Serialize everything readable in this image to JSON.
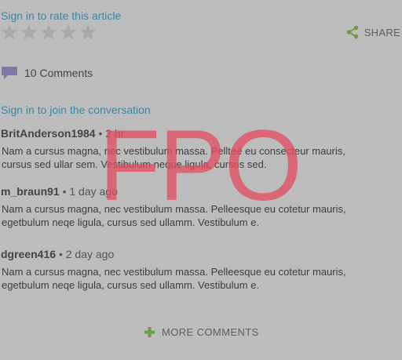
{
  "rating": {
    "sign_in_label": "Sign in to rate this article",
    "stars_filled": 0,
    "stars_total": 5
  },
  "share": {
    "label": "SHARE",
    "icon": "share-icon"
  },
  "comments": {
    "count_label": "10 Comments",
    "icon": "speech-bubble-icon",
    "join_label": "Sign in to join the conversation",
    "items": [
      {
        "author": "BritAnderson1984",
        "time": "• 2 hr",
        "body": "Nam a cursus magna, nec vestibulum massa. Pelltee eu consecteur mauris, cursus sed ullar sem. Vestibulum neque ligula, cursus sed."
      },
      {
        "author": "m_braun91",
        "time": "• 1 day ago",
        "body": "Nam a cursus magna, nec vestibulum massa. Pelleesque eu cotetur mauris, egetbulum neqe ligula, cursus sed ullamm. Vestibulum e."
      },
      {
        "author": "dgreen416",
        "time": "• 2 day ago",
        "body": "Nam a cursus magna, nec vestibulum massa. Pelleesque eu cotetur mauris, egetbulum neqe ligula, cursus sed ullamm. Vestibulum e."
      }
    ],
    "more_label": "MORE COMMENTS"
  },
  "watermark": {
    "text": "FPO"
  },
  "colors": {
    "background": "#bcbcbc",
    "link": "#3b86a3",
    "star": "#a9a9a9",
    "share_icon": "#6f9a45",
    "comment_icon": "#7f7aa6",
    "plus_icon": "#6f9a45",
    "watermark": "#e44b5f"
  }
}
